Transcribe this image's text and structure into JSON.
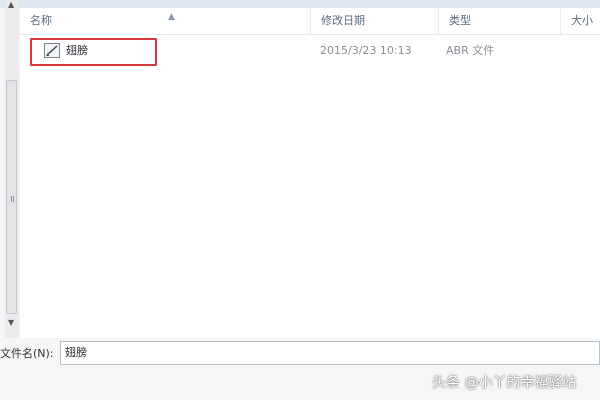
{
  "columns": {
    "name": "名称",
    "date_modified": "修改日期",
    "type": "类型",
    "size": "大小"
  },
  "files": [
    {
      "name": "翅膀",
      "date_modified": "2015/3/23 10:13",
      "type": "ABR 文件",
      "icon": "brush-file-icon"
    }
  ],
  "filename": {
    "label": "文件名(N):",
    "value": "翅膀"
  },
  "watermark": "头条 @小丫的幸福驿站",
  "colors": {
    "highlight": "#d9373c",
    "pane_bg": "#ffffff",
    "header_text": "#5a6a80"
  }
}
